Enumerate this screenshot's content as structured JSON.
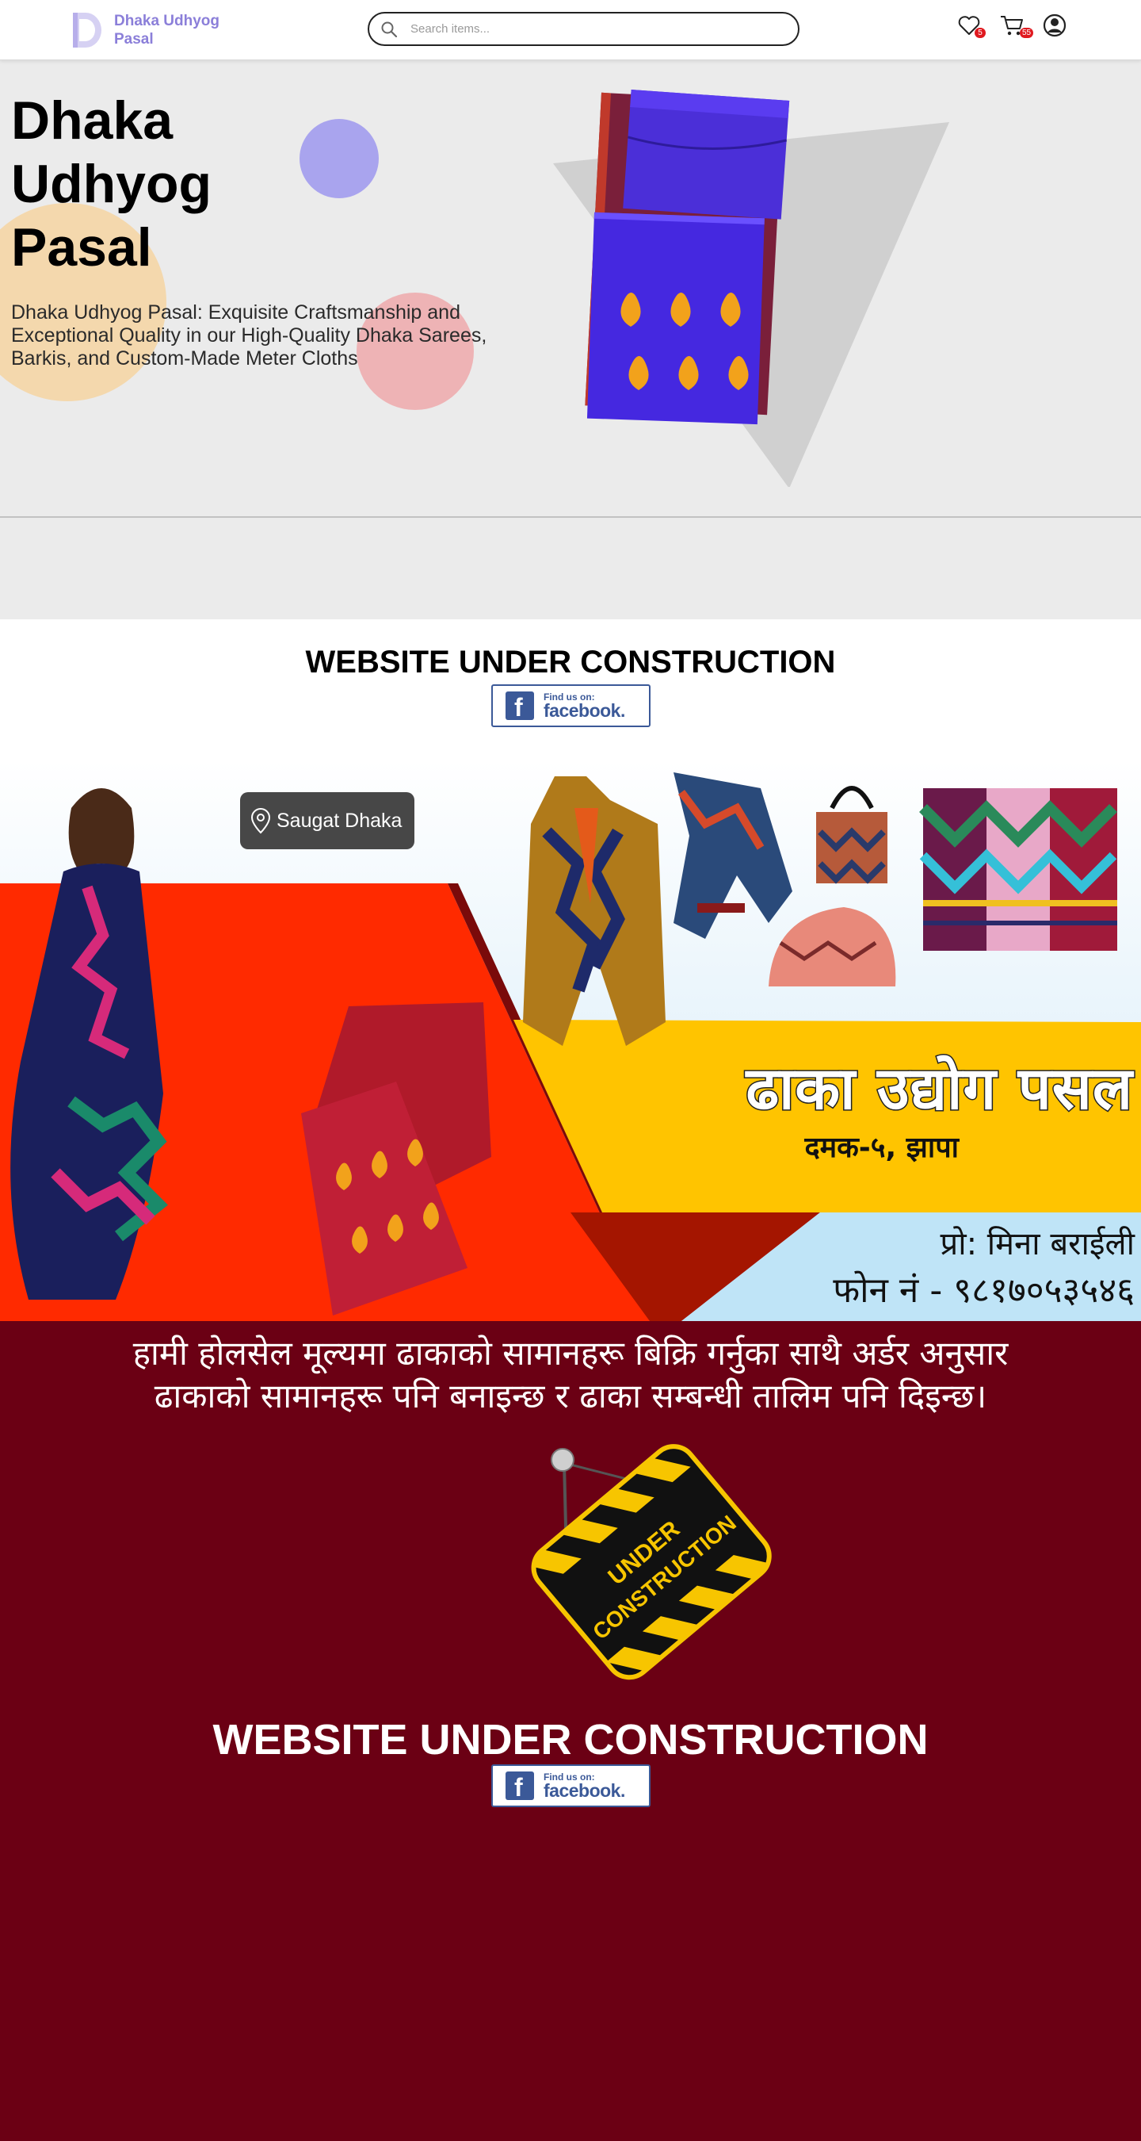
{
  "header": {
    "brand": "Dhaka Udhyog Pasal",
    "brand_line1": "Dhaka Udhyog",
    "brand_line2": "Pasal",
    "search_placeholder": "Search items...",
    "wishlist_count": "5",
    "cart_count": "55",
    "icons": [
      "logo-icon",
      "search-icon",
      "heart-icon",
      "cart-icon",
      "user-icon"
    ]
  },
  "hero": {
    "title_line1": "Dhaka",
    "title_line2": "Udhyog",
    "title_line3": "Pasal",
    "description": "Dhaka Udhyog Pasal: Exquisite Craftsmanship and Exceptional Quality in our High-Quality Dhaka Sarees, Barkis, and Custom-Made Meter Cloths"
  },
  "construction": {
    "heading": "WEBSITE UNDER CONSTRUCTION",
    "facebook_small": "Find us on:",
    "facebook_big": "facebook."
  },
  "banner": {
    "location_label": "Saugat Dhaka",
    "shop_name": "ढाका उद्योग पसल",
    "address": "दमक-५, झापा",
    "proprietor": "प्रो: मिना बराईली",
    "phone": "फोन नं - ९८१७०५३५४६"
  },
  "maroon": {
    "line1": "हामी होलसेल मूल्यमा ढाकाको सामानहरू बिक्रि गर्नुका साथै अर्डर अनुसार",
    "line2": "ढाकाको सामानहरू पनि बनाइन्छ र ढाका सम्बन्धी तालिम पनि दिइन्छ।",
    "sign_line1": "UNDER",
    "sign_line2": "CONSTRUCTION",
    "heading": "WEBSITE UNDER CONSTRUCTION",
    "facebook_small": "Find us on:",
    "facebook_big": "facebook."
  },
  "colors": {
    "brand": "#8b7fd9",
    "hero_bg": "#ebebeb",
    "maroon_bg": "#6b0014",
    "banner_red": "#ff2a00",
    "banner_yellow": "#ffc400",
    "facebook": "#3b5998",
    "badge": "#e0191f"
  }
}
